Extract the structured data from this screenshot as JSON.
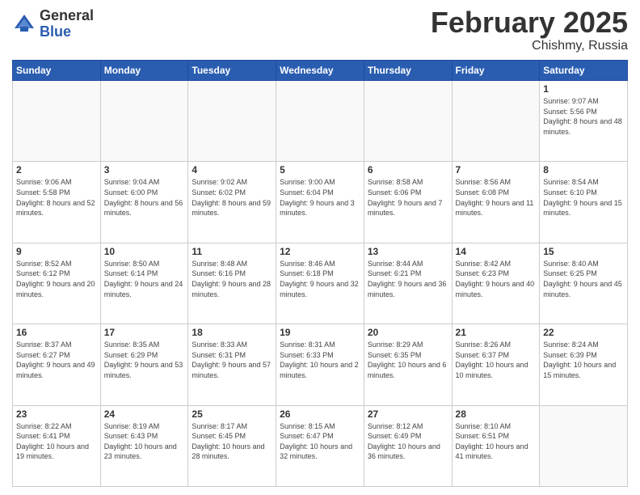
{
  "logo": {
    "general": "General",
    "blue": "Blue"
  },
  "header": {
    "month_year": "February 2025",
    "location": "Chishmy, Russia"
  },
  "days_of_week": [
    "Sunday",
    "Monday",
    "Tuesday",
    "Wednesday",
    "Thursday",
    "Friday",
    "Saturday"
  ],
  "weeks": [
    [
      {
        "day": "",
        "info": ""
      },
      {
        "day": "",
        "info": ""
      },
      {
        "day": "",
        "info": ""
      },
      {
        "day": "",
        "info": ""
      },
      {
        "day": "",
        "info": ""
      },
      {
        "day": "",
        "info": ""
      },
      {
        "day": "1",
        "info": "Sunrise: 9:07 AM\nSunset: 5:56 PM\nDaylight: 8 hours and 48 minutes."
      }
    ],
    [
      {
        "day": "2",
        "info": "Sunrise: 9:06 AM\nSunset: 5:58 PM\nDaylight: 8 hours and 52 minutes."
      },
      {
        "day": "3",
        "info": "Sunrise: 9:04 AM\nSunset: 6:00 PM\nDaylight: 8 hours and 56 minutes."
      },
      {
        "day": "4",
        "info": "Sunrise: 9:02 AM\nSunset: 6:02 PM\nDaylight: 8 hours and 59 minutes."
      },
      {
        "day": "5",
        "info": "Sunrise: 9:00 AM\nSunset: 6:04 PM\nDaylight: 9 hours and 3 minutes."
      },
      {
        "day": "6",
        "info": "Sunrise: 8:58 AM\nSunset: 6:06 PM\nDaylight: 9 hours and 7 minutes."
      },
      {
        "day": "7",
        "info": "Sunrise: 8:56 AM\nSunset: 6:08 PM\nDaylight: 9 hours and 11 minutes."
      },
      {
        "day": "8",
        "info": "Sunrise: 8:54 AM\nSunset: 6:10 PM\nDaylight: 9 hours and 15 minutes."
      }
    ],
    [
      {
        "day": "9",
        "info": "Sunrise: 8:52 AM\nSunset: 6:12 PM\nDaylight: 9 hours and 20 minutes."
      },
      {
        "day": "10",
        "info": "Sunrise: 8:50 AM\nSunset: 6:14 PM\nDaylight: 9 hours and 24 minutes."
      },
      {
        "day": "11",
        "info": "Sunrise: 8:48 AM\nSunset: 6:16 PM\nDaylight: 9 hours and 28 minutes."
      },
      {
        "day": "12",
        "info": "Sunrise: 8:46 AM\nSunset: 6:18 PM\nDaylight: 9 hours and 32 minutes."
      },
      {
        "day": "13",
        "info": "Sunrise: 8:44 AM\nSunset: 6:21 PM\nDaylight: 9 hours and 36 minutes."
      },
      {
        "day": "14",
        "info": "Sunrise: 8:42 AM\nSunset: 6:23 PM\nDaylight: 9 hours and 40 minutes."
      },
      {
        "day": "15",
        "info": "Sunrise: 8:40 AM\nSunset: 6:25 PM\nDaylight: 9 hours and 45 minutes."
      }
    ],
    [
      {
        "day": "16",
        "info": "Sunrise: 8:37 AM\nSunset: 6:27 PM\nDaylight: 9 hours and 49 minutes."
      },
      {
        "day": "17",
        "info": "Sunrise: 8:35 AM\nSunset: 6:29 PM\nDaylight: 9 hours and 53 minutes."
      },
      {
        "day": "18",
        "info": "Sunrise: 8:33 AM\nSunset: 6:31 PM\nDaylight: 9 hours and 57 minutes."
      },
      {
        "day": "19",
        "info": "Sunrise: 8:31 AM\nSunset: 6:33 PM\nDaylight: 10 hours and 2 minutes."
      },
      {
        "day": "20",
        "info": "Sunrise: 8:29 AM\nSunset: 6:35 PM\nDaylight: 10 hours and 6 minutes."
      },
      {
        "day": "21",
        "info": "Sunrise: 8:26 AM\nSunset: 6:37 PM\nDaylight: 10 hours and 10 minutes."
      },
      {
        "day": "22",
        "info": "Sunrise: 8:24 AM\nSunset: 6:39 PM\nDaylight: 10 hours and 15 minutes."
      }
    ],
    [
      {
        "day": "23",
        "info": "Sunrise: 8:22 AM\nSunset: 6:41 PM\nDaylight: 10 hours and 19 minutes."
      },
      {
        "day": "24",
        "info": "Sunrise: 8:19 AM\nSunset: 6:43 PM\nDaylight: 10 hours and 23 minutes."
      },
      {
        "day": "25",
        "info": "Sunrise: 8:17 AM\nSunset: 6:45 PM\nDaylight: 10 hours and 28 minutes."
      },
      {
        "day": "26",
        "info": "Sunrise: 8:15 AM\nSunset: 6:47 PM\nDaylight: 10 hours and 32 minutes."
      },
      {
        "day": "27",
        "info": "Sunrise: 8:12 AM\nSunset: 6:49 PM\nDaylight: 10 hours and 36 minutes."
      },
      {
        "day": "28",
        "info": "Sunrise: 8:10 AM\nSunset: 6:51 PM\nDaylight: 10 hours and 41 minutes."
      },
      {
        "day": "",
        "info": ""
      }
    ]
  ]
}
